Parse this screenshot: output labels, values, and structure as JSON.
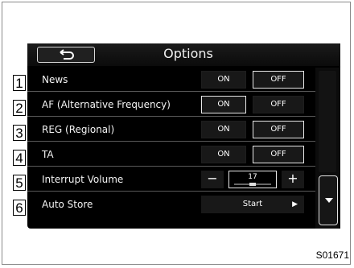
{
  "screen": {
    "title": "Options",
    "back_icon": "back-arrow-icon",
    "rows": [
      {
        "label": "News",
        "on": "ON",
        "off": "OFF",
        "selected": "off"
      },
      {
        "label": "AF (Alternative Frequency)",
        "on": "ON",
        "off": "OFF",
        "selected": "on"
      },
      {
        "label": "REG (Regional)",
        "on": "ON",
        "off": "OFF",
        "selected": "off"
      },
      {
        "label": "TA",
        "on": "ON",
        "off": "OFF",
        "selected": "off"
      },
      {
        "label": "Interrupt Volume",
        "minus": "−",
        "plus": "+",
        "value": "17",
        "level": 0.5
      },
      {
        "label": "Auto Store",
        "button": "Start"
      }
    ],
    "scroll_icon": "chevron-down-icon"
  },
  "callouts": [
    "1",
    "2",
    "3",
    "4",
    "5",
    "6"
  ],
  "figure_code": "S01671"
}
